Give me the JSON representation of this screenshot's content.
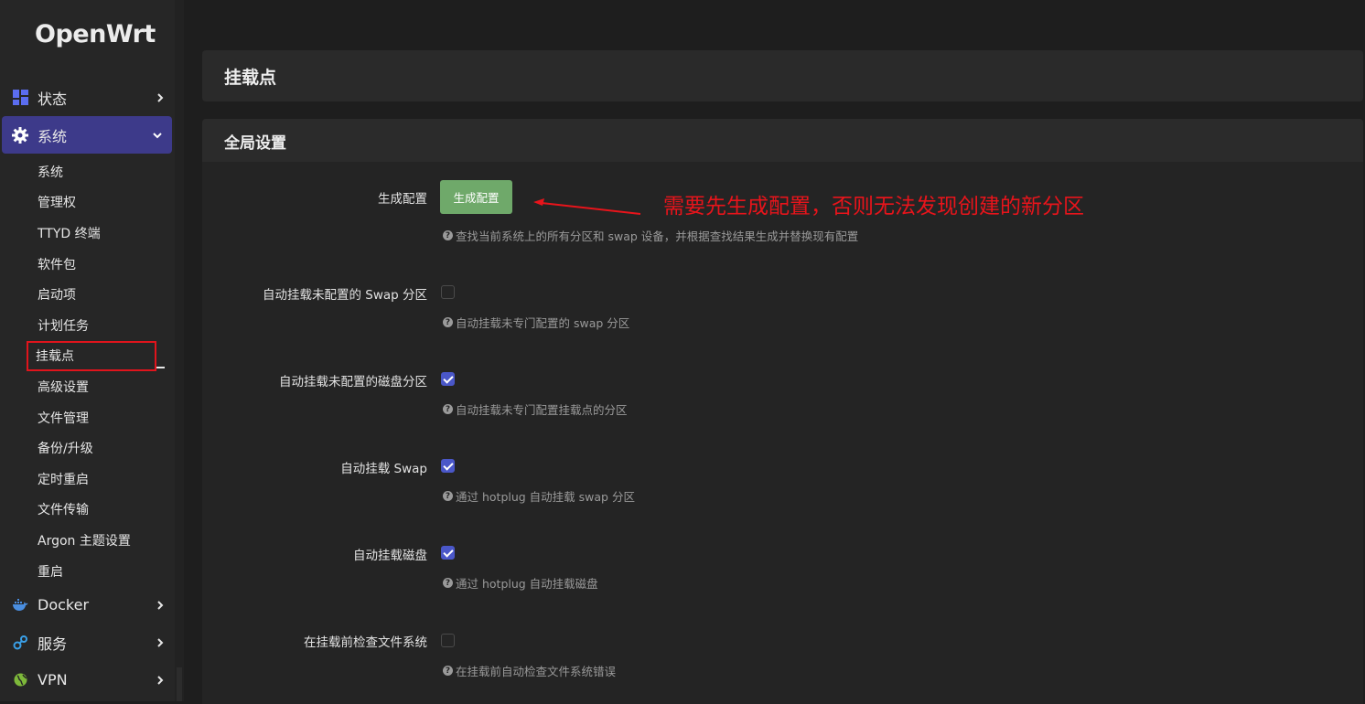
{
  "brand": "OpenWrt",
  "sidebar": {
    "items": [
      {
        "label": "状态",
        "icon": "dashboard-icon"
      },
      {
        "label": "系统",
        "icon": "gear-icon"
      },
      {
        "label": "Docker",
        "icon": "docker-icon"
      },
      {
        "label": "服务",
        "icon": "services-icon"
      },
      {
        "label": "VPN",
        "icon": "globe-icon"
      }
    ],
    "system_submenu": [
      "系统",
      "管理权",
      "TTYD 终端",
      "软件包",
      "启动项",
      "计划任务",
      "挂载点",
      "高级设置",
      "文件管理",
      "备份/升级",
      "定时重启",
      "文件传输",
      "Argon 主题设置",
      "重启"
    ]
  },
  "page": {
    "title": "挂载点"
  },
  "global_settings": {
    "title": "全局设置",
    "generate": {
      "label": "生成配置",
      "button": "生成配置",
      "help": "查找当前系统上的所有分区和 swap 设备，并根据查找结果生成并替换现有配置"
    },
    "fields": [
      {
        "label": "自动挂载未配置的 Swap 分区",
        "checked": false,
        "help": "自动挂载未专门配置的 swap 分区"
      },
      {
        "label": "自动挂载未配置的磁盘分区",
        "checked": true,
        "help": "自动挂载未专门配置挂载点的分区"
      },
      {
        "label": "自动挂载 Swap",
        "checked": true,
        "help": "通过 hotplug 自动挂载 swap 分区"
      },
      {
        "label": "自动挂载磁盘",
        "checked": true,
        "help": "通过 hotplug 自动挂载磁盘"
      },
      {
        "label": "在挂载前检查文件系统",
        "checked": false,
        "help": "在挂载前自动检查文件系统错误"
      }
    ]
  },
  "annotation": "需要先生成配置，否则无法发现创建的新分区",
  "colors": {
    "accent": "#3d3a8a",
    "button_green": "#6fa96a",
    "checkbox": "#4a57c8",
    "annotation_red": "#e8141b"
  }
}
